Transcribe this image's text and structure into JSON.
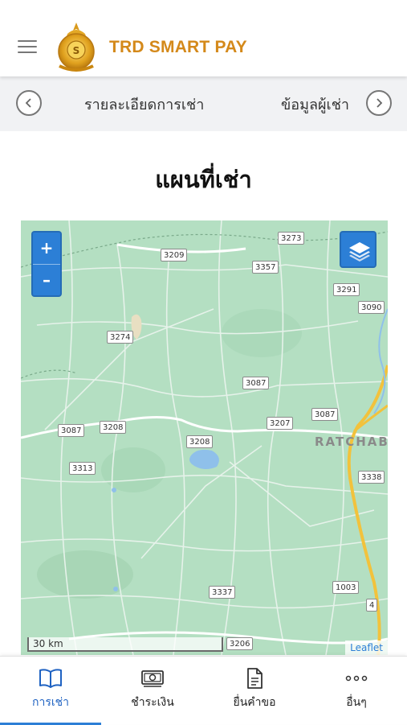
{
  "header": {
    "brand": "TRD SMART PAY"
  },
  "tabs": [
    {
      "label": "รายละเอียดการเช่า"
    },
    {
      "label": "ข้อมูลผู้เช่า"
    }
  ],
  "page": {
    "title": "แผนที่เช่า"
  },
  "map": {
    "zoom_in_label": "+",
    "zoom_out_label": "–",
    "place_label": "RATCHAB",
    "scale_label": "30 km",
    "attribution": "Leaflet",
    "road_labels": [
      "3273",
      "3209",
      "3357",
      "3291",
      "3090",
      "3274",
      "3087",
      "3087",
      "3208",
      "3207",
      "3087",
      "3208",
      "3313",
      "3338",
      "3337",
      "1003",
      "4",
      "3206"
    ]
  },
  "bottom_nav": [
    {
      "label": "การเช่า",
      "icon": "book-icon",
      "active": true
    },
    {
      "label": "ชำระเงิน",
      "icon": "money-icon",
      "active": false
    },
    {
      "label": "ยื่นคำขอ",
      "icon": "document-icon",
      "active": false
    },
    {
      "label": "อื่นๆ",
      "icon": "more-icon",
      "active": false
    }
  ],
  "colors": {
    "brand": "#d4891a",
    "accent": "#2c7fd6",
    "map_land": "#b4dfc2",
    "highway": "#f2c23c"
  }
}
